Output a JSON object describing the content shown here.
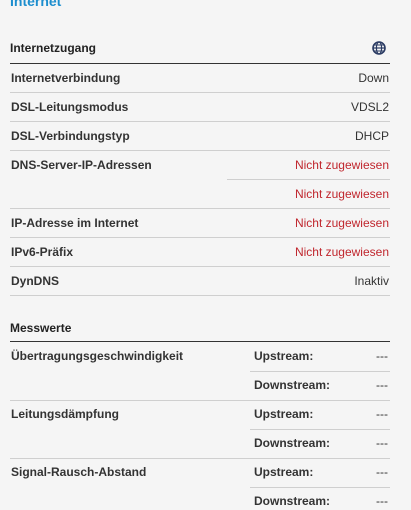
{
  "page": {
    "title": "Internet"
  },
  "access": {
    "title": "Internetzugang",
    "rows": [
      {
        "label": "Internetverbindung",
        "value": "Down"
      },
      {
        "label": "DSL-Leitungsmodus",
        "value": "VDSL2"
      },
      {
        "label": "DSL-Verbindungstyp",
        "value": "DHCP"
      },
      {
        "label": "DNS-Server-IP-Adressen",
        "value": "Nicht zugewiesen",
        "value2": "Nicht zugewiesen"
      },
      {
        "label": "IP-Adresse im Internet",
        "value": "Nicht zugewiesen"
      },
      {
        "label": "IPv6-Präfix",
        "value": "Nicht zugewiesen"
      },
      {
        "label": "DynDNS",
        "value": "Inaktiv"
      }
    ],
    "status_color": "#c0262d"
  },
  "measurements": {
    "title": "Messwerte",
    "groups": [
      {
        "label": "Übertragungsgeschwindigkeit",
        "up_label": "Upstream:",
        "up": "---",
        "down_label": "Downstream:",
        "down": "---"
      },
      {
        "label": "Leitungsdämpfung",
        "up_label": "Upstream:",
        "up": "---",
        "down_label": "Downstream:",
        "down": "---"
      },
      {
        "label": "Signal-Rausch-Abstand",
        "up_label": "Upstream:",
        "up": "---",
        "down_label": "Downstream:",
        "down": "---"
      }
    ]
  },
  "icons": {
    "globe": "globe-icon"
  },
  "colors": {
    "accent": "#1d8ece"
  }
}
